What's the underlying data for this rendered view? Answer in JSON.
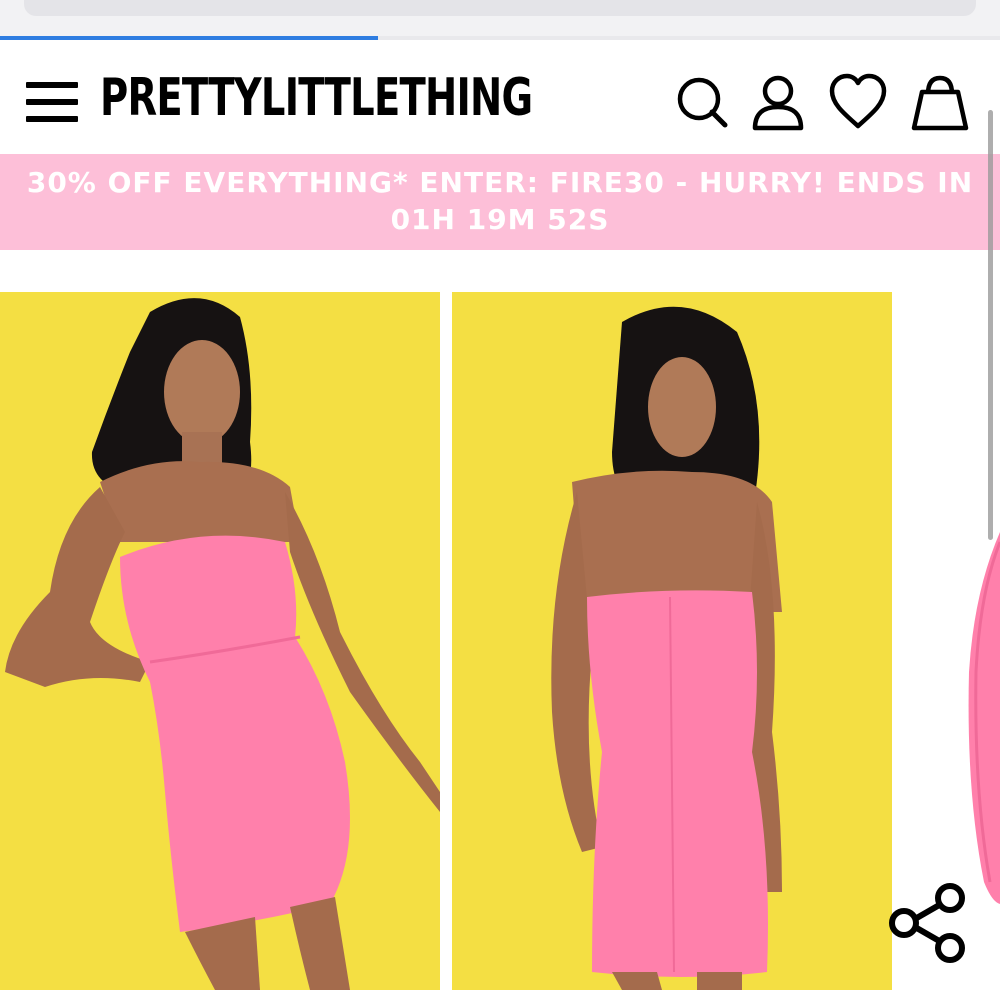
{
  "browser": {
    "load_progress": 0.378,
    "accent": "#2f7de1"
  },
  "header": {
    "brand": "PRETTYLITTLETHING",
    "icons": [
      "menu-icon",
      "search-icon",
      "account-icon",
      "wishlist-heart-icon",
      "shopping-bag-icon"
    ]
  },
  "banner": {
    "line1": "30% OFF EVERYTHING* ENTER: FIRE30 - HURRY! ENDS IN",
    "line2": "01H 19M 52S",
    "background": "#fdbfd8"
  },
  "gallery": {
    "background": "#f3dc3a",
    "dress_color": "#ff80ab",
    "images": [
      "front-view",
      "back-view",
      "side-view"
    ]
  },
  "actions": {
    "share_icon": "share-icon"
  }
}
